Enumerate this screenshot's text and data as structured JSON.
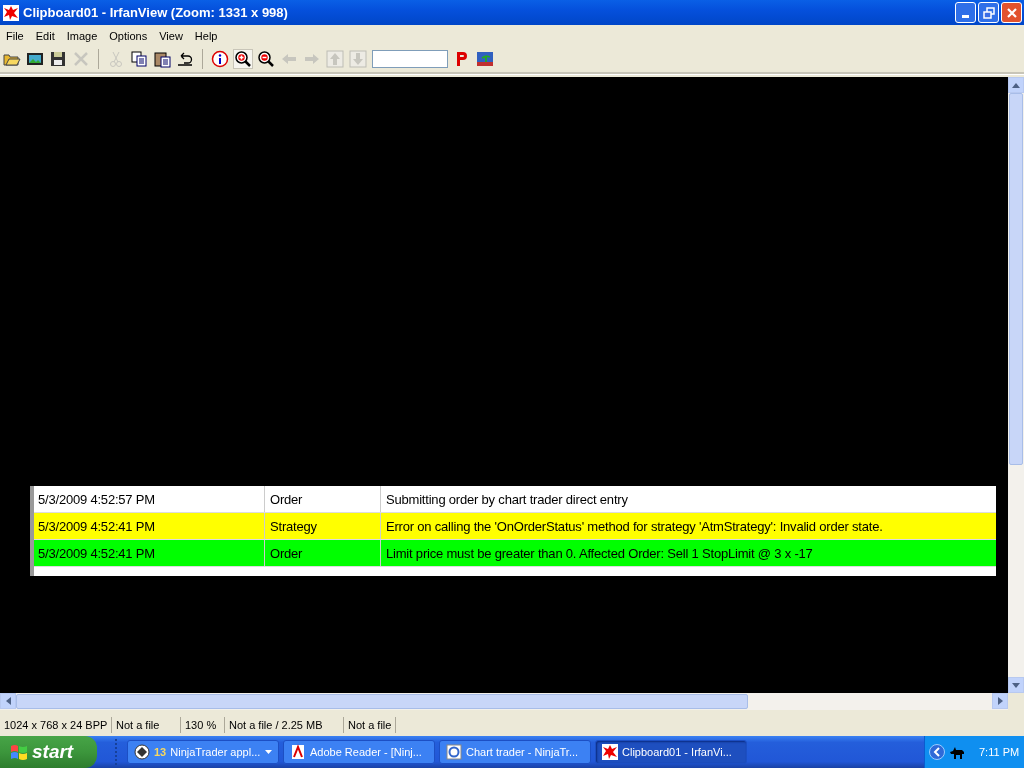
{
  "window": {
    "title": "Clipboard01 - IrfanView (Zoom: 1331 x 998)"
  },
  "menu": [
    "File",
    "Edit",
    "Image",
    "Options",
    "View",
    "Help"
  ],
  "toolbar": [
    {
      "kind": "open",
      "disabled": false
    },
    {
      "kind": "slideshow",
      "disabled": false
    },
    {
      "kind": "save",
      "disabled": false
    },
    {
      "kind": "delete",
      "disabled": true
    },
    {
      "kind": "sep"
    },
    {
      "kind": "cut",
      "disabled": true
    },
    {
      "kind": "copy",
      "disabled": false
    },
    {
      "kind": "paste",
      "disabled": false
    },
    {
      "kind": "undo",
      "disabled": false
    },
    {
      "kind": "sep"
    },
    {
      "kind": "info",
      "disabled": false
    },
    {
      "kind": "zoomin",
      "disabled": false
    },
    {
      "kind": "zoomout",
      "disabled": false
    },
    {
      "kind": "left",
      "disabled": true
    },
    {
      "kind": "right",
      "disabled": true
    },
    {
      "kind": "up",
      "disabled": true
    },
    {
      "kind": "down",
      "disabled": true
    },
    {
      "kind": "field"
    },
    {
      "kind": "p",
      "disabled": false
    },
    {
      "kind": "picture",
      "disabled": false
    }
  ],
  "log": [
    {
      "time": "5/3/2009 4:52:57 PM",
      "category": "Order",
      "message": "Submitting order by chart trader direct entry",
      "color": "#ffffff"
    },
    {
      "time": "5/3/2009 4:52:41 PM",
      "category": "Strategy",
      "message": "Error on calling the 'OnOrderStatus' method for strategy 'AtmStrategy': Invalid order state.",
      "color": "#ffff00"
    },
    {
      "time": "5/3/2009 4:52:41 PM",
      "category": "Order",
      "message": "Limit price must be greater than 0. Affected Order: Sell 1 StopLimit @ 3 x -17",
      "color": "#00ff00"
    }
  ],
  "status_bar": [
    "1024 x 768 x 24 BPP",
    "Not a file",
    "130 %",
    "Not a file / 2.25 MB",
    "Not a file"
  ],
  "taskbar": {
    "start": "start",
    "tasks": [
      {
        "count": "13",
        "label": "NinjaTrader appl...",
        "kind": "ninja",
        "selected": false
      },
      {
        "label": "Adobe Reader - [Ninj...",
        "kind": "adobe",
        "selected": false
      },
      {
        "label": "Chart trader - NinjaTr...",
        "kind": "ie",
        "selected": false
      },
      {
        "label": "Clipboard01 - IrfanVi...",
        "kind": "irfan",
        "selected": true
      }
    ],
    "clock": "7:11 PM"
  }
}
